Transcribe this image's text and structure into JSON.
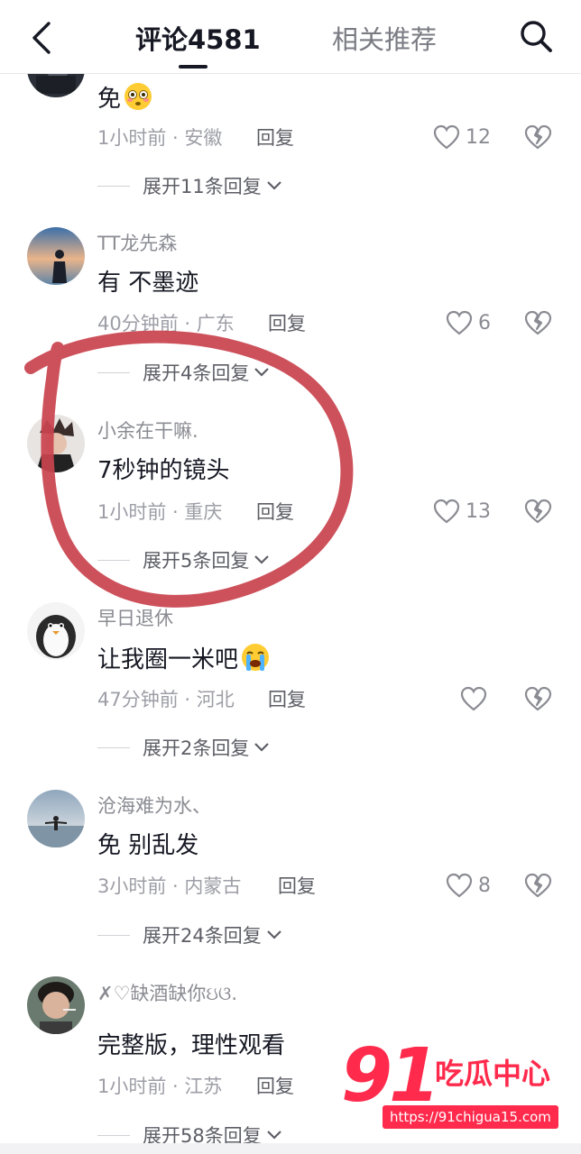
{
  "header": {
    "tab_comments": "评论4581",
    "tab_related": "相关推荐",
    "back_icon": "chevron-left-icon",
    "search_icon": "search-icon"
  },
  "comments": [
    {
      "username": "",
      "text": "免",
      "emoji": "flushed-face-emoji",
      "meta": "1小时前 · 安徽",
      "reply": "回复",
      "likes": "12",
      "expand": "展开11条回复"
    },
    {
      "username": "TT龙先森",
      "text": "有 不墨迹",
      "meta": "40分钟前 · 广东",
      "reply": "回复",
      "likes": "6",
      "expand": "展开4条回复"
    },
    {
      "username": "小余在干嘛.",
      "text": "7秒钟的镜头",
      "meta": "1小时前 · 重庆",
      "reply": "回复",
      "likes": "13",
      "expand": "展开5条回复"
    },
    {
      "username": "早日退休",
      "text": "让我圈一米吧",
      "emoji": "loudly-crying-face-emoji",
      "meta": "47分钟前 · 河北",
      "reply": "回复",
      "likes": "",
      "expand": "展开2条回复"
    },
    {
      "username": "沧海难为水、",
      "text": "免 别乱发",
      "meta": "3小时前 · 内蒙古",
      "reply": "回复",
      "likes": "8",
      "expand": "展开24条回复"
    },
    {
      "username": "✗♡缺酒缺你ઇଓ.",
      "text": "完整版，理性观看",
      "meta": "1小时前 · 江苏",
      "reply": "回复",
      "likes": "",
      "expand": "展开58条回复"
    }
  ],
  "watermark": {
    "number": "91",
    "name": "吃瓜中心",
    "url": "https://91chigua15.com"
  },
  "colors": {
    "accent_red": "#ff2a4c",
    "annotation_circle": "#c9444f",
    "text_primary": "#161823",
    "text_secondary": "#8b8c93"
  }
}
